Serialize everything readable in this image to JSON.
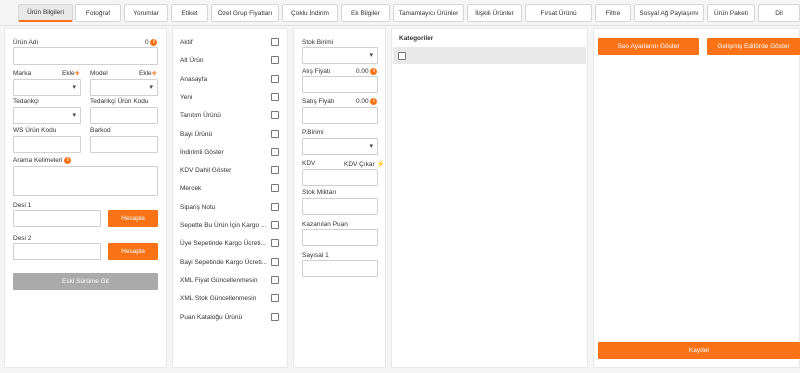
{
  "tabs": [
    {
      "label": "Ürün Bilgileri",
      "active": true
    },
    {
      "label": "Fotoğraf"
    },
    {
      "label": "Yorumlar"
    },
    {
      "label": "Etiket"
    },
    {
      "label": "Özel Grup Fiyatları"
    },
    {
      "label": "Çoklu İndirim"
    },
    {
      "label": "Ek Bilgiler"
    },
    {
      "label": "Tamamlayıcı Ürünler"
    },
    {
      "label": "İlişkili Ürünler"
    },
    {
      "label": "Fırsat Ürünü"
    },
    {
      "label": "Filtre"
    },
    {
      "label": "Sosyal Ağ Paylaşımı"
    },
    {
      "label": "Ürün Paketi"
    },
    {
      "label": "Dil"
    }
  ],
  "form": {
    "urun_adi": "Ürün Adı",
    "urun_adi_count": "0",
    "marka": "Marka",
    "ekle": "Ekle",
    "model": "Model",
    "tedarikci": "Tedarikçi",
    "tedarikci_urun_kodu": "Tedarikçi Ürün Kodu",
    "ws_urun_kodu": "WS Ürün Kodu",
    "barkod": "Barkod",
    "arama_kelimeleri": "Arama Kelimeleri",
    "desi1": "Desi 1",
    "desi2": "Desi 2",
    "hesapla": "Hesapla",
    "eski_surume_git": "Eski Sürüme Git"
  },
  "checkboxes": [
    "Aktif",
    "Alt Ürün",
    "Anasayfa",
    "Yeni",
    "Tanıtım Ürünü",
    "Bayi Ürünü",
    "İndirimli Göster",
    "KDV Dahil Göster",
    "Mercek",
    "Sipariş Notu",
    "Sepette Bu Ürün İçin Kargo ...",
    "Üye Sepetinde Kargo Ücreti...",
    "Bayi Sepetinde Kargo Ücreti...",
    "XML Fiyat Güncellenmesin",
    "XML Stok Güncellenmesin",
    "Puan Kataloğu Ürünü"
  ],
  "stock": {
    "stok_birimi": "Stok Birimi",
    "alis_fiyati": "Alış Fiyatı",
    "alis_value": "0.00",
    "satis_fiyati": "Satış Fiyatı",
    "satis_value": "0.00",
    "p_birimi": "P.Birimi",
    "kdv": "KDV",
    "kdv_cikar": "KDV Çıkar",
    "stok_miktari": "Stok Miktarı",
    "kazanilan_puan": "Kazanılan Puan",
    "sayisal1": "Sayısal 1"
  },
  "categories": {
    "title": "Kategoriler"
  },
  "actions": {
    "seo": "Seo Ayarlarını Göster",
    "editor": "Gelişmiş Editörde Göster",
    "kaydet": "Kaydet"
  },
  "colors": {
    "accent": "#f97316"
  }
}
